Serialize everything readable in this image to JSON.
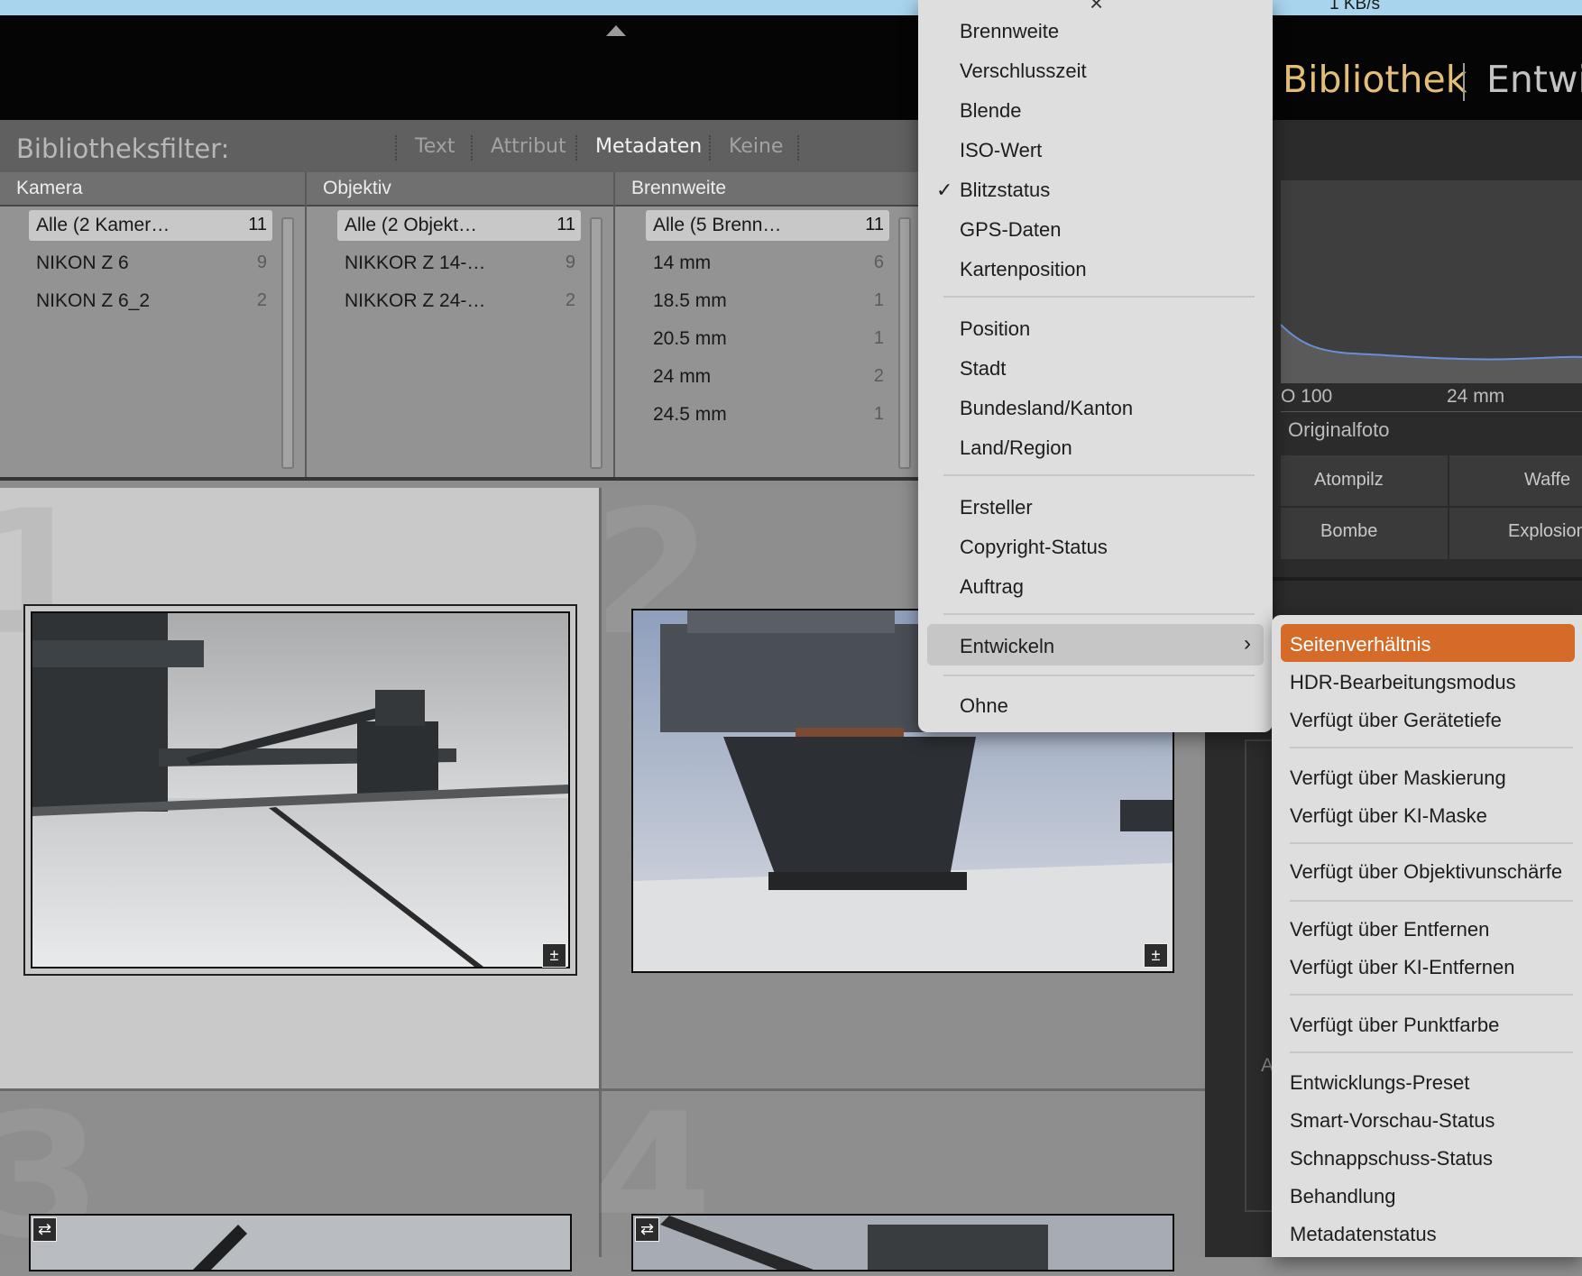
{
  "top": {
    "status_speed": "1 KB/s",
    "modules": [
      "Bibliothek",
      "Entwic"
    ]
  },
  "filterbar": {
    "title": "Bibliotheksfilter:",
    "tabs": [
      "Text",
      "Attribut",
      "Metadaten",
      "Keine"
    ],
    "active_tab": "Metadaten"
  },
  "metadata_columns": [
    {
      "header": "Kamera",
      "rows": [
        {
          "label": "Alle (2 Kamer…",
          "count": "11"
        },
        {
          "label": "NIKON Z 6",
          "count": "9"
        },
        {
          "label": "NIKON Z 6_2",
          "count": "2"
        }
      ]
    },
    {
      "header": "Objektiv",
      "rows": [
        {
          "label": "Alle (2 Objekt…",
          "count": "11"
        },
        {
          "label": "NIKKOR Z 14-…",
          "count": "9"
        },
        {
          "label": "NIKKOR Z 24-…",
          "count": "2"
        }
      ]
    },
    {
      "header": "Brennweite",
      "rows": [
        {
          "label": "Alle (5 Brenn…",
          "count": "11"
        },
        {
          "label": "14 mm",
          "count": "6"
        },
        {
          "label": "18.5 mm",
          "count": "1"
        },
        {
          "label": "20.5 mm",
          "count": "1"
        },
        {
          "label": "24 mm",
          "count": "2"
        },
        {
          "label": "24.5 mm",
          "count": "1"
        }
      ]
    }
  ],
  "grid": {
    "cell_numbers": [
      "1",
      "2",
      "3",
      "4"
    ]
  },
  "right_panel": {
    "iso": "O 100",
    "focal": "24 mm",
    "original": "Originalfoto",
    "presets": [
      "Atompilz",
      "Waffe",
      "Bombe",
      "Explosion"
    ],
    "partial_label": "A"
  },
  "menu": {
    "close_glyph": "×",
    "groups": [
      [
        "Brennweite",
        "Verschlusszeit",
        "Blende",
        "ISO-Wert",
        "Blitzstatus",
        "GPS-Daten",
        "Kartenposition"
      ],
      [
        "Position",
        "Stadt",
        "Bundesland/Kanton",
        "Land/Region"
      ],
      [
        "Ersteller",
        "Copyright-Status",
        "Auftrag"
      ],
      [
        "Entwickeln"
      ],
      [
        "Ohne"
      ]
    ],
    "checked_item": "Blitzstatus",
    "highlighted_item": "Entwickeln"
  },
  "submenu": {
    "items": [
      "Seitenverhältnis",
      "HDR-Bearbeitungsmodus",
      "Verfügt über Gerätetiefe",
      "Verfügt über Maskierung",
      "Verfügt über KI-Maske",
      "Verfügt über Objektivunschärfe",
      "Verfügt über Entfernen",
      "Verfügt über KI-Entfernen",
      "Verfügt über Punktfarbe",
      "Entwicklungs-Preset",
      "Smart-Vorschau-Status",
      "Schnappschuss-Status",
      "Behandlung",
      "Metadatenstatus"
    ],
    "selected_item": "Seitenverhältnis"
  },
  "colors": {
    "module_active": "#e2be76",
    "menu_selected": "#d56b28",
    "menubar": "#a9d4ee"
  }
}
